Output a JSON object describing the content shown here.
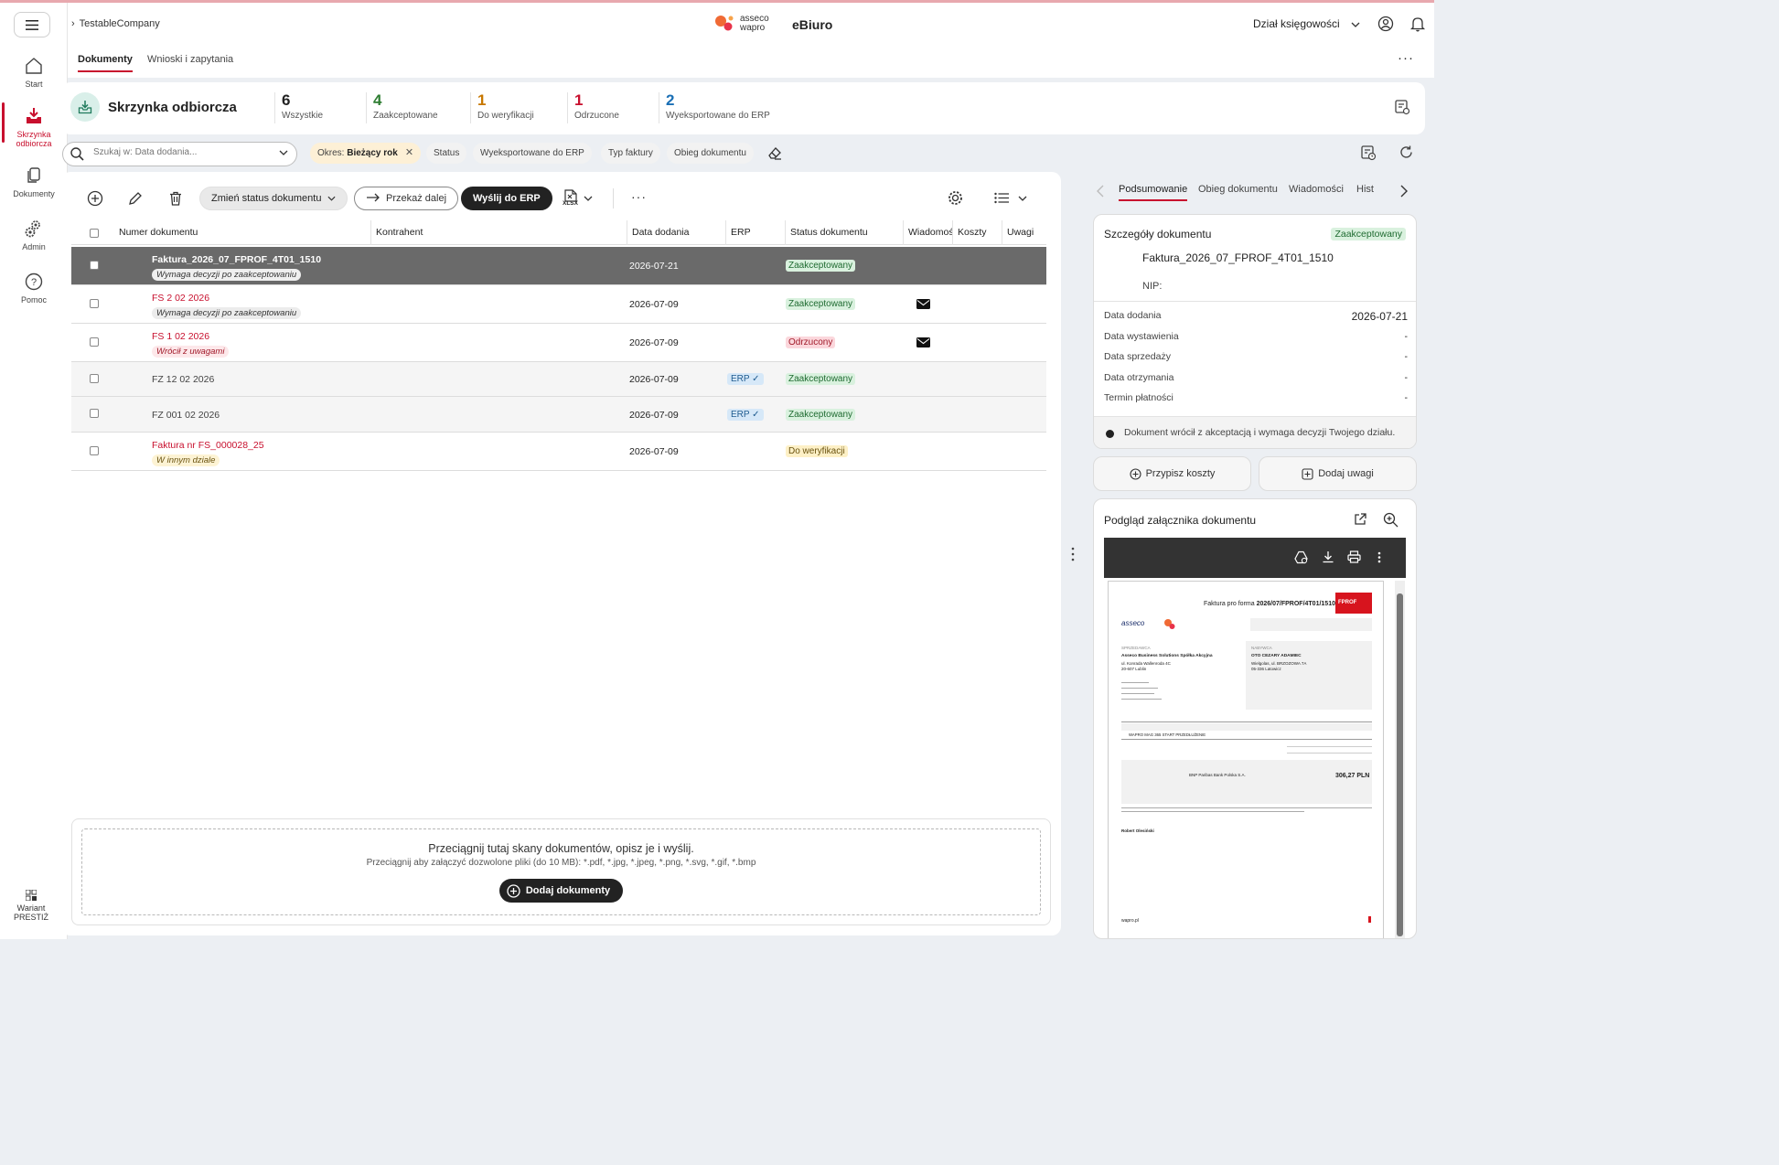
{
  "header": {
    "breadcrumb": "TestableCompany",
    "logo_line1": "asseco",
    "logo_line2": "wapro",
    "app_name": "eBiuro",
    "department": "Dział księgowości"
  },
  "nav": {
    "items": [
      {
        "label": "Start",
        "icon": "home-icon"
      },
      {
        "label": "Skrzynka odbiorcza",
        "icon": "inbox-download-icon"
      },
      {
        "label": "Dokumenty",
        "icon": "documents-icon"
      },
      {
        "label": "Admin",
        "icon": "admin-gears-icon"
      },
      {
        "label": "Pomoc",
        "icon": "help-icon"
      }
    ],
    "variant_line1": "Wariant",
    "variant_line2": "PRESTIŻ"
  },
  "tabs": {
    "items": [
      "Dokumenty",
      "Wnioski i zapytania"
    ],
    "active": "Dokumenty"
  },
  "summary": {
    "title": "Skrzynka odbiorcza",
    "stats": [
      {
        "count": "6",
        "label": "Wszystkie",
        "color": "#222222"
      },
      {
        "count": "4",
        "label": "Zaakceptowane",
        "color": "#2e7d32"
      },
      {
        "count": "1",
        "label": "Do weryfikacji",
        "color": "#c77700"
      },
      {
        "count": "1",
        "label": "Odrzucone",
        "color": "#c8102e"
      },
      {
        "count": "2",
        "label": "Wyeksportowane do ERP",
        "color": "#1a6fb5"
      }
    ]
  },
  "filters": {
    "search_placeholder": "Szukaj w: Data dodania...",
    "period_label": "Okres:",
    "period_value": "Bieżący rok",
    "chips": [
      "Status",
      "Wyeksportowane do ERP",
      "Typ faktury",
      "Obieg dokumentu"
    ]
  },
  "toolbar": {
    "change_status": "Zmień status dokumentu",
    "forward": "Przekaż dalej",
    "send_erp": "Wyślij do ERP",
    "xlsx": "XLSX"
  },
  "table": {
    "columns": [
      "Numer dokumentu",
      "Kontrahent",
      "Data dodania",
      "ERP",
      "Status dokumentu",
      "Wiadomości",
      "Koszty",
      "Uwagi"
    ],
    "rows": [
      {
        "number": "Faktura_2026_07_FPROF_4T01_1510",
        "note": "Wymaga decyzji po zaakceptowaniu",
        "date": "2026-07-21",
        "erp": "",
        "status": "Zaakceptowany"
      },
      {
        "number": "FS 2 02 2026",
        "note": "Wymaga decyzji po zaakceptowaniu",
        "date": "2026-07-09",
        "erp": "",
        "status": "Zaakceptowany"
      },
      {
        "number": "FS 1 02 2026",
        "note": "Wrócił z uwagami",
        "date": "2026-07-09",
        "erp": "",
        "status": "Odrzucony"
      },
      {
        "number": "FZ 12 02 2026",
        "note": "",
        "date": "2026-07-09",
        "erp": "ERP",
        "status": "Zaakceptowany"
      },
      {
        "number": "FZ 001 02 2026",
        "note": "",
        "date": "2026-07-09",
        "erp": "ERP",
        "status": "Zaakceptowany"
      },
      {
        "number": "Faktura nr FS_000028_25",
        "note": "W innym dziale",
        "date": "2026-07-09",
        "erp": "",
        "status": "Do weryfikacji"
      }
    ]
  },
  "dropzone": {
    "title": "Przeciągnij tutaj skany dokumentów, opisz je i wyślij.",
    "subtitle": "Przeciągnij aby załączyć dozwolone pliki (do 10 MB): *.pdf, *.jpg, *.jpeg, *.png, *.svg, *.gif, *.bmp",
    "button": "Dodaj dokumenty"
  },
  "right": {
    "tabs": [
      "Podsumowanie",
      "Obieg dokumentu",
      "Wiadomości",
      "Historia"
    ],
    "tab_visible": [
      "Podsumowanie",
      "Obieg dokumentu",
      "Wiadomości",
      "Hist"
    ],
    "details": {
      "title": "Szczegóły dokumentu",
      "status": "Zaakceptowany",
      "doc_name": "Faktura_2026_07_FPROF_4T01_1510",
      "nip_label": "NIP:",
      "fields": [
        {
          "label": "Data dodania",
          "value": "2026-07-21"
        },
        {
          "label": "Data wystawienia",
          "value": "-"
        },
        {
          "label": "Data sprzedaży",
          "value": "-"
        },
        {
          "label": "Data otrzymania",
          "value": "-"
        },
        {
          "label": "Termin płatności",
          "value": "-"
        }
      ],
      "footer": "Dokument wrócił z akceptacją i wymaga decyzji Twojego działu."
    },
    "actions": {
      "assign_costs": "Przypisz koszty",
      "add_notes": "Dodaj uwagi"
    },
    "preview": {
      "title": "Podgląd załącznika dokumentu",
      "doc_header": "Faktura pro forma",
      "doc_number": "2026/07/FPROF/4T01/1510",
      "doc_badge": "FPROF",
      "seller_label": "SPRZEDAWCA",
      "seller_name": "Asseco Business Solutions Spółka Akcyjna",
      "seller_addr1": "ul. Konrada Wallenroda 4C",
      "seller_addr2": "20-607 Lublin",
      "buyer_label": "NABYWCA",
      "buyer_name": "OTO CEZARY ADAMIEC",
      "buyer_addr1": "Wielgolas, ul. BRZOZOWA 7A",
      "buyer_addr2": "05-336 Latowicz",
      "item": "WAPRO MAG 365 START PRZEDŁUŻENIE",
      "total": "306,27 PLN",
      "bank": "BNP Paribas Bank Polska S.A.",
      "issuer": "Robert Olesiński",
      "footer_site": "wapro.pl"
    }
  }
}
